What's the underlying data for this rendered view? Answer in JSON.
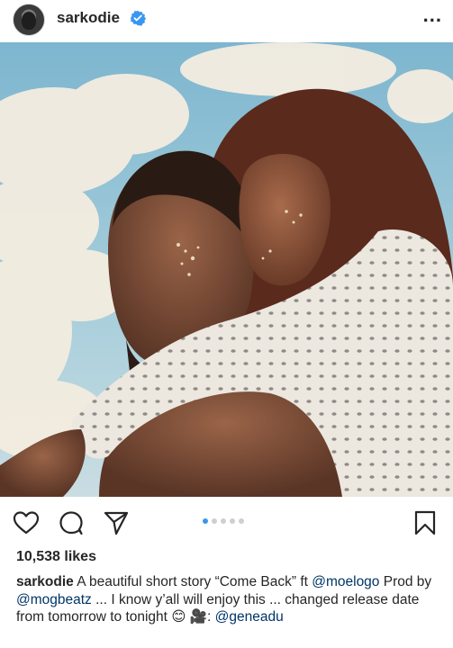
{
  "header": {
    "username": "sarkodie",
    "more_label": "..."
  },
  "post": {
    "carousel": {
      "count": 5,
      "active_index": 0
    },
    "likes": "10,538 likes",
    "caption": {
      "user": "sarkodie",
      "segments": [
        {
          "type": "text",
          "value": " A beautiful short story “Come Back” ft "
        },
        {
          "type": "mention",
          "value": "@moelogo"
        },
        {
          "type": "text",
          "value": " Prod by "
        },
        {
          "type": "mention",
          "value": "@mogbeatz"
        },
        {
          "type": "text",
          "value": " ... I know y’all will enjoy this ... changed release date from tomorrow to tonight 😊 🎥: "
        },
        {
          "type": "mention",
          "value": "@geneadu"
        }
      ]
    }
  },
  "colors": {
    "accent": "#3897f0",
    "text": "#262626",
    "mention": "#003569"
  }
}
